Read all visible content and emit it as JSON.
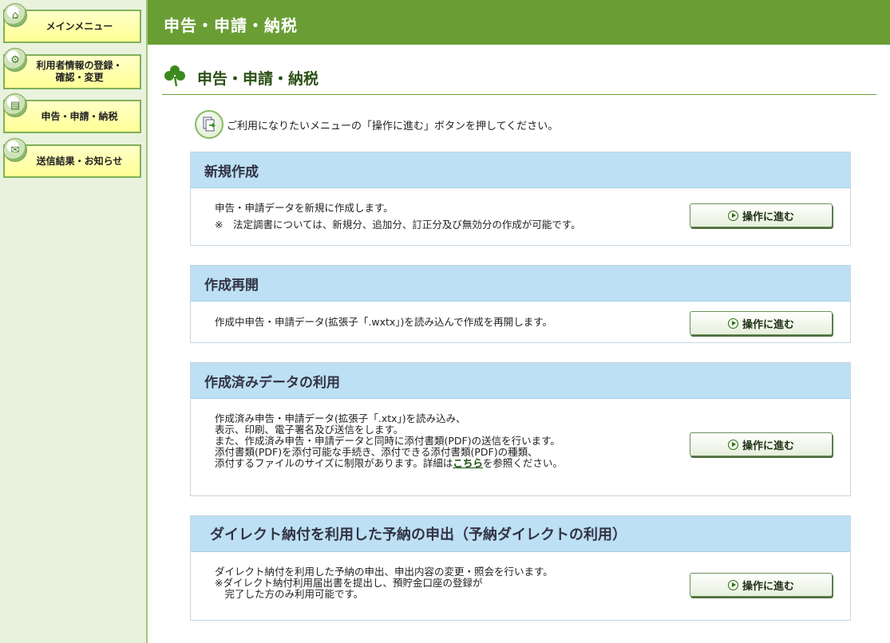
{
  "sidebar": {
    "items": [
      {
        "label": "メインメニュー",
        "icon": "home-icon"
      },
      {
        "label": "利用者情報の登録・\n確認・変更",
        "icon": "user-settings-icon"
      },
      {
        "label": "申告・申請・納税",
        "icon": "document-icon"
      },
      {
        "label": "送信結果・お知らせ",
        "icon": "notice-icon"
      }
    ]
  },
  "header": {
    "title": "申告・申請・納税"
  },
  "page": {
    "title": "申告・申請・納税",
    "instruction": "ご利用になりたいメニューの「操作に進む」ボタンを押してください。"
  },
  "sections": [
    {
      "title": "新規作成",
      "lines": [
        "申告・申請データを新規に作成します。",
        "※　法定調書については、新規分、追加分、訂正分及び無効分の作成が可能です。"
      ],
      "button": "操作に進む"
    },
    {
      "title": "作成再開",
      "lines": [
        "作成中申告・申請データ(拡張子「.wxtx」)を読み込んで作成を再開します。"
      ],
      "button": "操作に進む"
    },
    {
      "title": "作成済みデータの利用",
      "lines": [
        "作成済み申告・申請データ(拡張子「.xtx」)を読み込み、",
        "表示、印刷、電子署名及び送信をします。",
        "また、作成済み申告・申請データと同時に添付書類(PDF)の送信を行います。",
        "添付書類(PDF)を添付可能な手続き、添付できる添付書類(PDF)の種類、"
      ],
      "last_line_pre": "添付するファイルのサイズに制限があります。詳細は",
      "link": "こちら",
      "last_line_post": "を参照ください。",
      "button": "操作に進む"
    },
    {
      "title": "ダイレクト納付を利用した予納の申出（予納ダイレクトの利用）",
      "lines": [
        "ダイレクト納付を利用した予納の申出、申出内容の変更・照会を行います。",
        "※ダイレクト納付利用届出書を提出し、預貯金口座の登録が",
        "　完了した方のみ利用可能です。"
      ],
      "button": "操作に進む"
    }
  ],
  "colors": {
    "header_bg": "#6a9e34",
    "panel_head_bg": "#bde0f4",
    "nav_btn_bg": "#ffff96"
  }
}
